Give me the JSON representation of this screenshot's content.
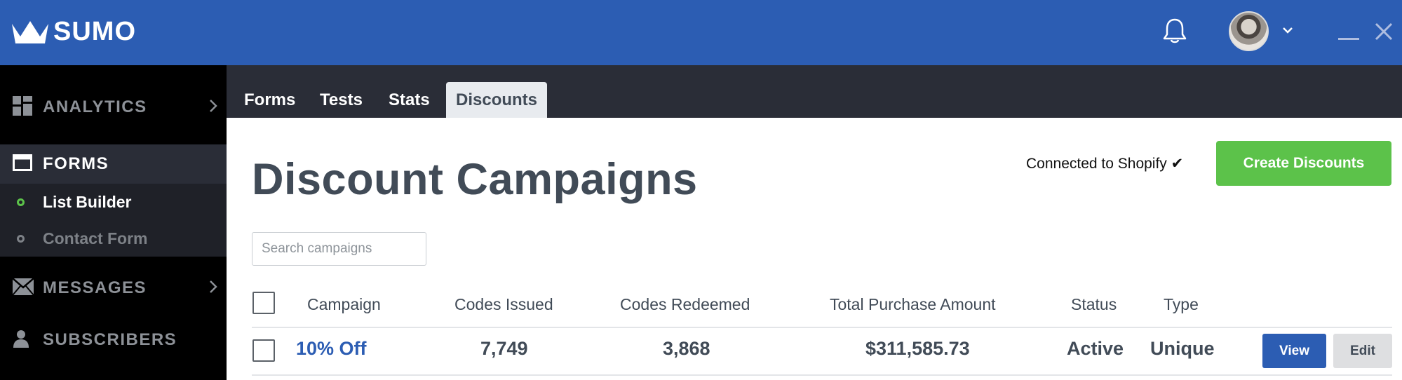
{
  "app": {
    "name": "SUMO"
  },
  "header": {
    "icons": [
      "crown-logo-icon",
      "bell-icon",
      "avatar",
      "chevron-down-icon",
      "minimize-icon",
      "close-icon"
    ]
  },
  "sidebar": {
    "items": [
      {
        "label": "ANALYTICS",
        "icon": "dashboard-icon"
      },
      {
        "label": "FORMS",
        "icon": "window-icon"
      },
      {
        "label": "MESSAGES",
        "icon": "envelope-icon"
      },
      {
        "label": "SUBSCRIBERS",
        "icon": "user-icon"
      }
    ],
    "sub_items": [
      {
        "label": "List Builder",
        "active": true
      },
      {
        "label": "Contact Form",
        "active": false
      }
    ]
  },
  "tabs": [
    {
      "label": "Forms",
      "active": false
    },
    {
      "label": "Tests",
      "active": false
    },
    {
      "label": "Stats",
      "active": false
    },
    {
      "label": "Discounts",
      "active": true
    }
  ],
  "main": {
    "title": "Discount Campaigns",
    "connected_text": "Connected to Shopify ✔",
    "create_button": "Create Discounts",
    "search_placeholder": "Search campaigns"
  },
  "table": {
    "headers": [
      "Campaign",
      "Codes Issued",
      "Codes Redeemed",
      "Total Purchase Amount",
      "Status",
      "Type"
    ],
    "rows": [
      {
        "campaign": "10% Off",
        "codes_issued": "7,749",
        "codes_redeemed": "3,868",
        "total_purchase_amount": "$311,585.73",
        "status": "Active",
        "type": "Unique",
        "view_label": "View",
        "edit_label": "Edit"
      }
    ]
  },
  "colors": {
    "topbar": "#2c5db3",
    "sidebar": "#000000",
    "tabbar": "#2a2d37",
    "accent_green": "#5cc24a",
    "link_blue": "#2c5db3"
  }
}
